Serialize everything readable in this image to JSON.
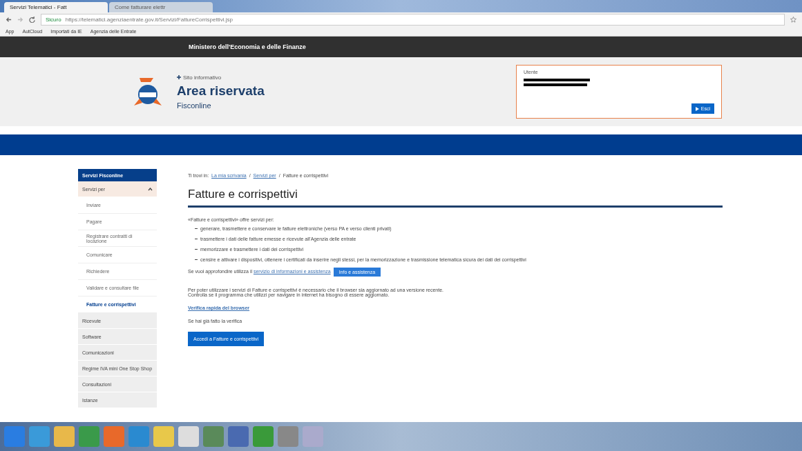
{
  "browser": {
    "tabs": [
      {
        "label": "Servizi Telematici - Fatt",
        "selected": true
      },
      {
        "label": "Come fatturare elettr",
        "selected": false
      }
    ],
    "address": {
      "secure_label": "Sicuro",
      "url": "https://telematici.agenziaentrate.gov.it/Servizi/FattureCorrispettivi.jsp"
    },
    "bookmarks": [
      "App",
      "AutCloud",
      "Importati da IE",
      "Agenzia delle Entrate"
    ]
  },
  "top_bar": {
    "title": "Ministero dell'Economia e delle Finanze"
  },
  "header": {
    "back_link": "Sito informativo",
    "title": "Area riservata",
    "subtitle": "Fisconline",
    "user": {
      "label": "Utente",
      "exit_button": "Esci"
    }
  },
  "sidebar": {
    "title": "Servizi Fisconline",
    "items": [
      {
        "label": "Servizi per",
        "expanded": true,
        "children": [
          {
            "label": "Inviare",
            "selected": false
          },
          {
            "label": "Pagare",
            "selected": false
          },
          {
            "label": "Registrare contratti di locazione",
            "selected": false
          },
          {
            "label": "Comunicare",
            "selected": false
          },
          {
            "label": "Richiedere",
            "selected": false
          },
          {
            "label": "Validare e consultare file",
            "selected": false
          },
          {
            "label": "Fatture e corrispettivi",
            "selected": true
          }
        ]
      },
      {
        "label": "Ricevute",
        "expanded": false
      },
      {
        "label": "Software",
        "expanded": false
      },
      {
        "label": "Comunicazioni",
        "expanded": false
      },
      {
        "label": "Regime IVA mini One Stop Shop",
        "expanded": false
      },
      {
        "label": "Consultazioni",
        "expanded": false
      },
      {
        "label": "Istanze",
        "expanded": false
      }
    ]
  },
  "breadcrumb": {
    "prefix": "Ti trovi in:",
    "links": [
      "La mia scrivania",
      "Servizi per"
    ],
    "separator": "/",
    "current": "Fatture e corrispettivi"
  },
  "content": {
    "heading": "Fatture e corrispettivi",
    "intro": "«Fatture e corrispettivi» offre servizi per:",
    "bullets": [
      "generare, trasmettere e conservare le fatture elettroniche (verso PA e verso clienti privati)",
      "trasmettere i dati delle fatture emesse e ricevute all'Agenzia delle entrate",
      "memorizzare e trasmettere i dati dei corrispettivi",
      "censire e attivare i dispositivi, ottenere i certificati da inserire negli stessi, per la memorizzazione e trasmissione telematica sicura dei dati dei corrispettivi"
    ],
    "help_text": "Se vuoi approfondire utilizza il",
    "help_link": "servizio di informazioni e assistenza",
    "help_banner": "Info e assistenza",
    "browser_note": [
      "Per poter utilizzare i servizi di Fatture e corrispettivi è necessario che il browser sia aggiornato ad una versione recente.",
      "Controlla se il programma che utilizzi per navigare in internet ha bisogno di essere aggiornato."
    ],
    "check_link": "Verifica rapida del browser",
    "done_text": "Se hai già fatto la verifica",
    "access_button": "Accedi a Fatture e corrispettivi"
  }
}
